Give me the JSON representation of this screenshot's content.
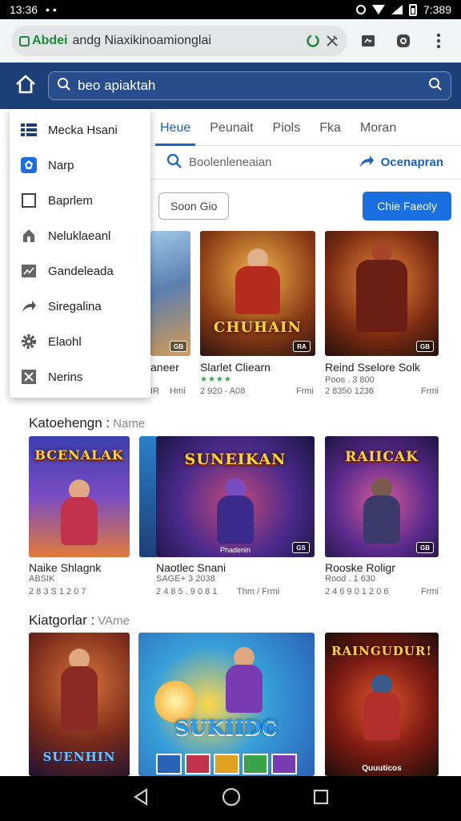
{
  "status_bar": {
    "time": "13:36",
    "battery": "7:389"
  },
  "browser": {
    "site_label": "Abdei",
    "url": "andg Niaxikinoamionglai"
  },
  "app_header": {
    "search_text": "beo apiaktah"
  },
  "tabs": [
    {
      "label": "Heue",
      "active": true
    },
    {
      "label": "Peunait",
      "active": false
    },
    {
      "label": "Piols",
      "active": false
    },
    {
      "label": "Fka",
      "active": false
    },
    {
      "label": "Moran",
      "active": false
    }
  ],
  "subrow": {
    "search_placeholder": "Boolenleneaian",
    "link_label": "Ocenapran"
  },
  "buttons": {
    "outline_label": "Soon Gio",
    "primary_label": "Chie Faeoly"
  },
  "drawer": {
    "items": [
      {
        "label": "Mecka Hsani",
        "icon": "list-icon"
      },
      {
        "label": "Narp",
        "icon": "badge-icon"
      },
      {
        "label": "Baprlem",
        "icon": "square-icon"
      },
      {
        "label": "Neluklaeanl",
        "icon": "home-icon"
      },
      {
        "label": "Gandeleada",
        "icon": "image-icon"
      },
      {
        "label": "Siregalina",
        "icon": "share-icon"
      },
      {
        "label": "Elaohl",
        "icon": "gear-icon"
      },
      {
        "label": "Nerins",
        "icon": "tools-icon"
      }
    ]
  },
  "row1": {
    "cards": [
      {
        "name": "aneer",
        "meta": "IR",
        "size": "Hmi",
        "thumb_title": "",
        "badge": "GB"
      },
      {
        "name": "Slarlet Cliearn",
        "meta": "2 920 - A08",
        "size": "Frmi",
        "thumb_title": "CHUHAIN",
        "badge": "RA",
        "stars": "★★★★"
      },
      {
        "name": "Reind Sselore Solk",
        "meta": "Poos . 3 800",
        "meta2": "2 8350 1236",
        "size": "Frmi",
        "thumb_title": "",
        "badge": "GB"
      }
    ]
  },
  "section2": {
    "title": "Katoehengn :",
    "muted": "Name"
  },
  "row2": {
    "cards": [
      {
        "name": "Naike Shlagnk",
        "meta": "2 8 3 S 1 2 0 7",
        "meta0": "ABSIK",
        "size": "",
        "thumb_title": "BCENALAK",
        "badge": ""
      },
      {
        "name": "Naotlec Snani",
        "meta0": "SAGE+ 3 2038",
        "meta": "2 4 8 5 . 9 0 8 1",
        "size": "Thm / Frmi",
        "thumb_title": "SUNEIKAN",
        "badge": "GS",
        "sub_caption": "Phadenin"
      },
      {
        "name": "Rooske Roligr",
        "meta0": "Rood . 1 630",
        "meta": "2 4 6 9 0 1 2 0 6",
        "size": "Frmi",
        "thumb_title": "RAIICAK",
        "badge": "GB"
      }
    ]
  },
  "section3": {
    "title": "Kiatgorlar :",
    "muted": "VAme"
  },
  "row3": {
    "cards": [
      {
        "thumb_title": "SUENHIN"
      },
      {
        "thumb_title": "SUKIIDC"
      },
      {
        "thumb_title": "RAINGUDUR!",
        "sub_caption": "Quuuticos"
      }
    ]
  },
  "theme": {
    "header_bg": "#1d3f78",
    "accent": "#1a62c6",
    "primary_button": "#1a6fe0"
  }
}
